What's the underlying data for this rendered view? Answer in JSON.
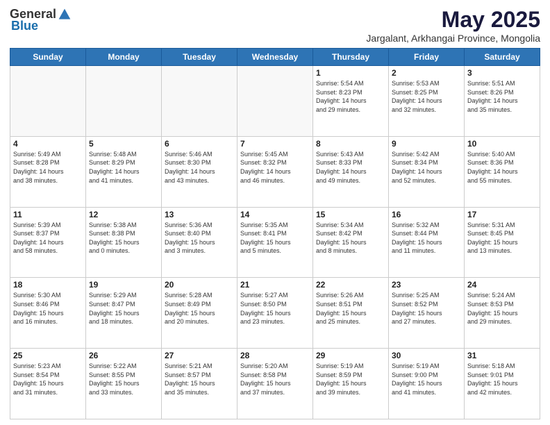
{
  "header": {
    "logo_general": "General",
    "logo_blue": "Blue",
    "month_title": "May 2025",
    "subtitle": "Jargalant, Arkhangai Province, Mongolia"
  },
  "calendar": {
    "days_of_week": [
      "Sunday",
      "Monday",
      "Tuesday",
      "Wednesday",
      "Thursday",
      "Friday",
      "Saturday"
    ],
    "weeks": [
      [
        {
          "day": "",
          "info": ""
        },
        {
          "day": "",
          "info": ""
        },
        {
          "day": "",
          "info": ""
        },
        {
          "day": "",
          "info": ""
        },
        {
          "day": "1",
          "info": "Sunrise: 5:54 AM\nSunset: 8:23 PM\nDaylight: 14 hours\nand 29 minutes."
        },
        {
          "day": "2",
          "info": "Sunrise: 5:53 AM\nSunset: 8:25 PM\nDaylight: 14 hours\nand 32 minutes."
        },
        {
          "day": "3",
          "info": "Sunrise: 5:51 AM\nSunset: 8:26 PM\nDaylight: 14 hours\nand 35 minutes."
        }
      ],
      [
        {
          "day": "4",
          "info": "Sunrise: 5:49 AM\nSunset: 8:28 PM\nDaylight: 14 hours\nand 38 minutes."
        },
        {
          "day": "5",
          "info": "Sunrise: 5:48 AM\nSunset: 8:29 PM\nDaylight: 14 hours\nand 41 minutes."
        },
        {
          "day": "6",
          "info": "Sunrise: 5:46 AM\nSunset: 8:30 PM\nDaylight: 14 hours\nand 43 minutes."
        },
        {
          "day": "7",
          "info": "Sunrise: 5:45 AM\nSunset: 8:32 PM\nDaylight: 14 hours\nand 46 minutes."
        },
        {
          "day": "8",
          "info": "Sunrise: 5:43 AM\nSunset: 8:33 PM\nDaylight: 14 hours\nand 49 minutes."
        },
        {
          "day": "9",
          "info": "Sunrise: 5:42 AM\nSunset: 8:34 PM\nDaylight: 14 hours\nand 52 minutes."
        },
        {
          "day": "10",
          "info": "Sunrise: 5:40 AM\nSunset: 8:36 PM\nDaylight: 14 hours\nand 55 minutes."
        }
      ],
      [
        {
          "day": "11",
          "info": "Sunrise: 5:39 AM\nSunset: 8:37 PM\nDaylight: 14 hours\nand 58 minutes."
        },
        {
          "day": "12",
          "info": "Sunrise: 5:38 AM\nSunset: 8:38 PM\nDaylight: 15 hours\nand 0 minutes."
        },
        {
          "day": "13",
          "info": "Sunrise: 5:36 AM\nSunset: 8:40 PM\nDaylight: 15 hours\nand 3 minutes."
        },
        {
          "day": "14",
          "info": "Sunrise: 5:35 AM\nSunset: 8:41 PM\nDaylight: 15 hours\nand 5 minutes."
        },
        {
          "day": "15",
          "info": "Sunrise: 5:34 AM\nSunset: 8:42 PM\nDaylight: 15 hours\nand 8 minutes."
        },
        {
          "day": "16",
          "info": "Sunrise: 5:32 AM\nSunset: 8:44 PM\nDaylight: 15 hours\nand 11 minutes."
        },
        {
          "day": "17",
          "info": "Sunrise: 5:31 AM\nSunset: 8:45 PM\nDaylight: 15 hours\nand 13 minutes."
        }
      ],
      [
        {
          "day": "18",
          "info": "Sunrise: 5:30 AM\nSunset: 8:46 PM\nDaylight: 15 hours\nand 16 minutes."
        },
        {
          "day": "19",
          "info": "Sunrise: 5:29 AM\nSunset: 8:47 PM\nDaylight: 15 hours\nand 18 minutes."
        },
        {
          "day": "20",
          "info": "Sunrise: 5:28 AM\nSunset: 8:49 PM\nDaylight: 15 hours\nand 20 minutes."
        },
        {
          "day": "21",
          "info": "Sunrise: 5:27 AM\nSunset: 8:50 PM\nDaylight: 15 hours\nand 23 minutes."
        },
        {
          "day": "22",
          "info": "Sunrise: 5:26 AM\nSunset: 8:51 PM\nDaylight: 15 hours\nand 25 minutes."
        },
        {
          "day": "23",
          "info": "Sunrise: 5:25 AM\nSunset: 8:52 PM\nDaylight: 15 hours\nand 27 minutes."
        },
        {
          "day": "24",
          "info": "Sunrise: 5:24 AM\nSunset: 8:53 PM\nDaylight: 15 hours\nand 29 minutes."
        }
      ],
      [
        {
          "day": "25",
          "info": "Sunrise: 5:23 AM\nSunset: 8:54 PM\nDaylight: 15 hours\nand 31 minutes."
        },
        {
          "day": "26",
          "info": "Sunrise: 5:22 AM\nSunset: 8:55 PM\nDaylight: 15 hours\nand 33 minutes."
        },
        {
          "day": "27",
          "info": "Sunrise: 5:21 AM\nSunset: 8:57 PM\nDaylight: 15 hours\nand 35 minutes."
        },
        {
          "day": "28",
          "info": "Sunrise: 5:20 AM\nSunset: 8:58 PM\nDaylight: 15 hours\nand 37 minutes."
        },
        {
          "day": "29",
          "info": "Sunrise: 5:19 AM\nSunset: 8:59 PM\nDaylight: 15 hours\nand 39 minutes."
        },
        {
          "day": "30",
          "info": "Sunrise: 5:19 AM\nSunset: 9:00 PM\nDaylight: 15 hours\nand 41 minutes."
        },
        {
          "day": "31",
          "info": "Sunrise: 5:18 AM\nSunset: 9:01 PM\nDaylight: 15 hours\nand 42 minutes."
        }
      ]
    ]
  }
}
